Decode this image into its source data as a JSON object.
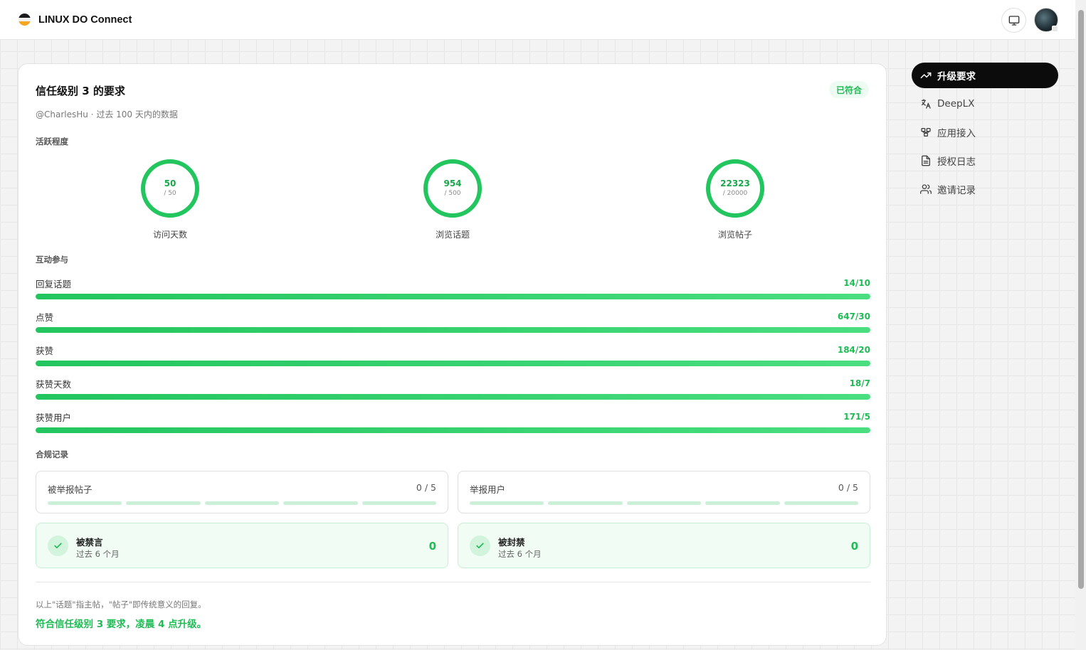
{
  "app": {
    "title": "LINUX DO Connect"
  },
  "card": {
    "title": "信任级别 3 的要求",
    "badge": "已符合",
    "subtitle": "@CharlesHu · 过去 100 天内的数据",
    "sections": {
      "activity": "活跃程度",
      "interaction": "互动参与",
      "compliance": "合规记录"
    },
    "rings": [
      {
        "label": "访问天数",
        "value": "50",
        "target": "/ 50",
        "fraction": 1.0
      },
      {
        "label": "浏览话题",
        "value": "954",
        "target": "/ 500",
        "fraction": 1.0
      },
      {
        "label": "浏览帖子",
        "value": "22323",
        "target": "/ 20000",
        "fraction": 1.0
      }
    ],
    "bars": [
      {
        "label": "回复话题",
        "value": "14/10",
        "fraction": 1.0
      },
      {
        "label": "点赞",
        "value": "647/30",
        "fraction": 1.0
      },
      {
        "label": "获赞",
        "value": "184/20",
        "fraction": 1.0
      },
      {
        "label": "获赞天数",
        "value": "18/7",
        "fraction": 1.0
      },
      {
        "label": "获赞用户",
        "value": "171/5",
        "fraction": 1.0
      }
    ],
    "reports": [
      {
        "label": "被举报帖子",
        "count": "0 / 5"
      },
      {
        "label": "举报用户",
        "count": "0 / 5"
      }
    ],
    "penalties": [
      {
        "title": "被禁言",
        "sub": "过去 6 个月",
        "count": "0"
      },
      {
        "title": "被封禁",
        "sub": "过去 6 个月",
        "count": "0"
      }
    ],
    "note": "以上\"话题\"指主帖，\"帖子\"即传统意义的回复。",
    "result": "符合信任级别 3 要求，凌晨 4 点升级。"
  },
  "nav": {
    "items": [
      {
        "label": "升级要求",
        "icon": "trending-up-icon",
        "active": true
      },
      {
        "label": "DeepLX",
        "icon": "translate-icon",
        "active": false
      },
      {
        "label": "应用接入",
        "icon": "apps-icon",
        "active": false
      },
      {
        "label": "授权日志",
        "icon": "document-icon",
        "active": false
      },
      {
        "label": "邀请记录",
        "icon": "users-icon",
        "active": false
      }
    ]
  },
  "colors": {
    "accent": "#1fbb55",
    "nav_active_bg": "#0c0c0c"
  }
}
